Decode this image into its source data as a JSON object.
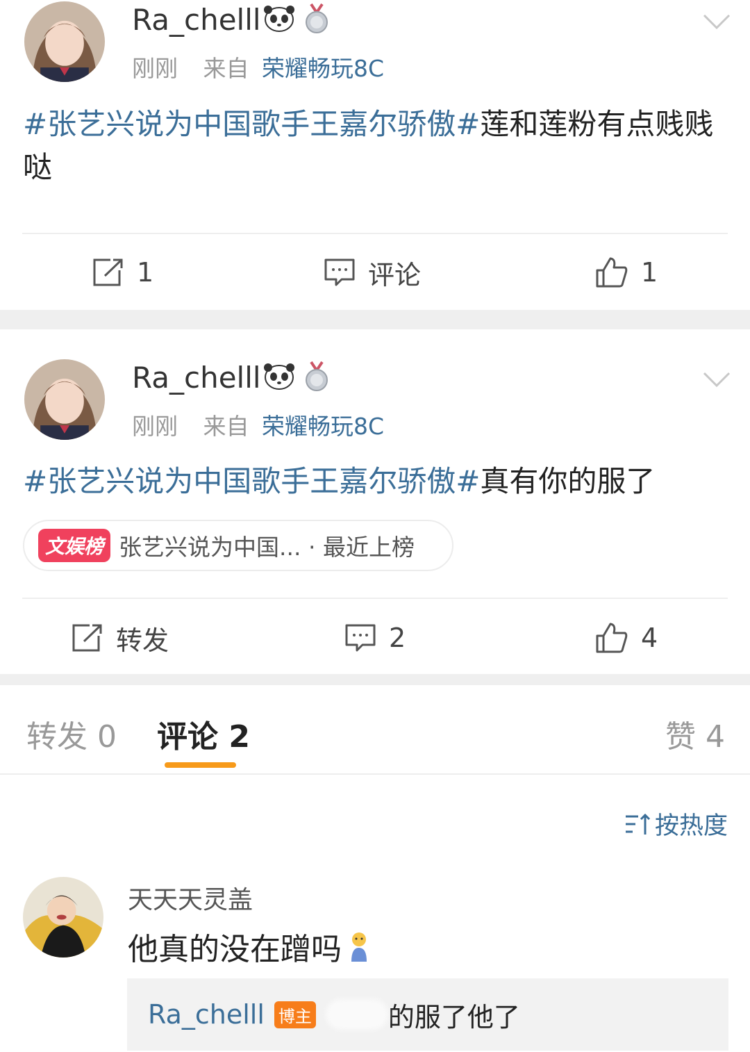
{
  "posts": [
    {
      "username": "Ra_chelll",
      "time": "刚刚",
      "source_prefix": "来自",
      "source": "荣耀畅玩8C",
      "hashtag": "#张艺兴说为中国歌手王嘉尔骄傲#",
      "text": "莲和莲粉有点贱贱哒",
      "repost": "1",
      "comment": "评论",
      "like": "1"
    },
    {
      "username": "Ra_chelll",
      "time": "刚刚",
      "source_prefix": "来自",
      "source": "荣耀畅玩8C",
      "hashtag": "#张艺兴说为中国歌手王嘉尔骄傲#",
      "text": "真有你的服了",
      "hot_tag": "文娱榜",
      "hot_text": "张艺兴说为中国... · 最近上榜",
      "repost": "转发",
      "comment": "2",
      "like": "4"
    }
  ],
  "tabs": {
    "repost": "转发 0",
    "comment": "评论 2",
    "like": "赞 4"
  },
  "sort_label": "按热度",
  "comment": {
    "username": "天天天灵盖",
    "text": "他真的没在蹭吗",
    "reply_user": "Ra_chelll",
    "reply_badge": "博主",
    "reply_text": "的服了他了"
  },
  "colors": {
    "link": "#3b6e98",
    "accent": "#f79a1a",
    "hot": "#f0415d"
  }
}
